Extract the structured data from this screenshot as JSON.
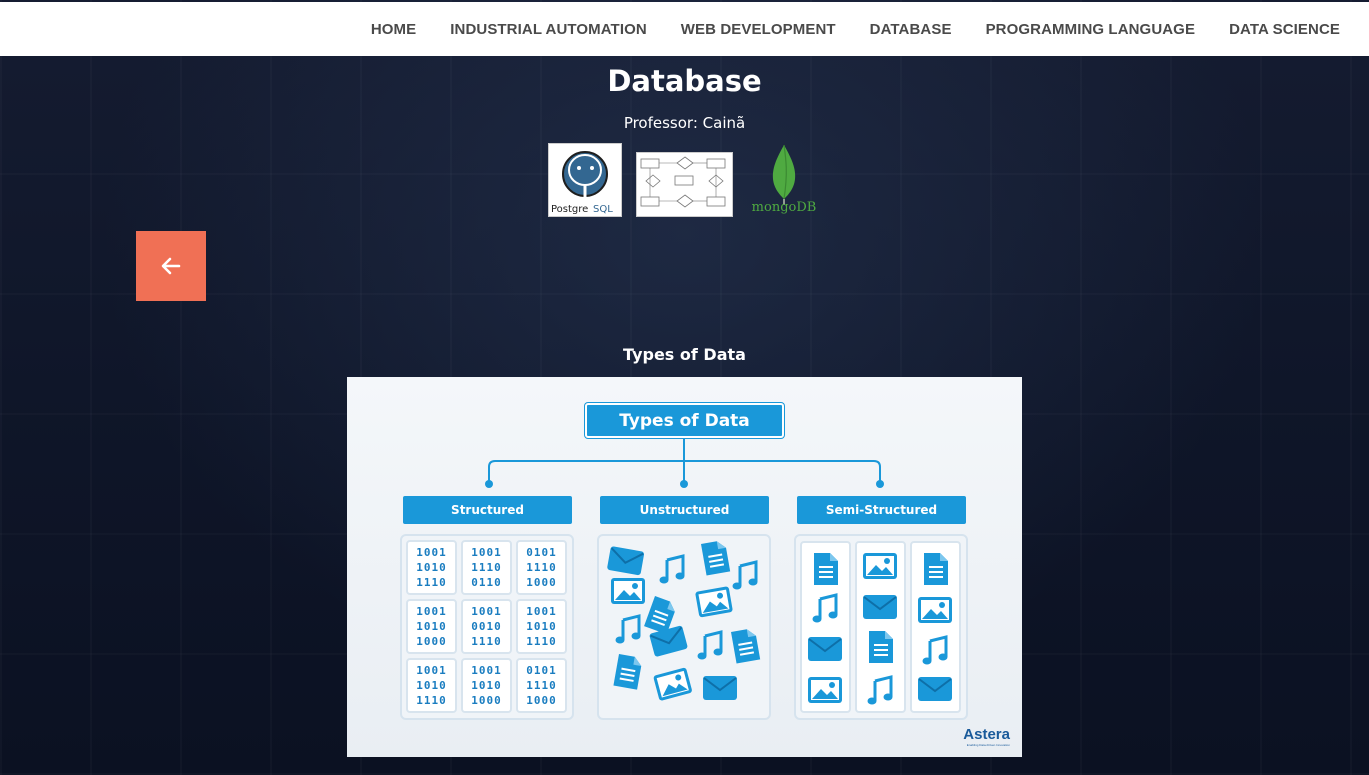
{
  "nav": {
    "items": [
      {
        "label": "HOME"
      },
      {
        "label": "INDUSTRIAL AUTOMATION"
      },
      {
        "label": "WEB DEVELOPMENT"
      },
      {
        "label": "DATABASE"
      },
      {
        "label": "PROGRAMMING LANGUAGE"
      },
      {
        "label": "DATA SCIENCE"
      }
    ]
  },
  "page": {
    "title": "Database",
    "professor": "Professor: Cainã"
  },
  "logos": {
    "postgres_text_left": "Postgre",
    "postgres_text_right": "SQL",
    "mongo_text": "mongoDB"
  },
  "back_button": {
    "icon": "arrow-left-icon"
  },
  "section": {
    "title": "Types of Data"
  },
  "figure": {
    "title": "Types of Data",
    "columns": [
      {
        "label": "Structured"
      },
      {
        "label": "Unstructured"
      },
      {
        "label": "Semi-Structured"
      }
    ],
    "binary_cells": [
      [
        "1001",
        "1010",
        "1110"
      ],
      [
        "1001",
        "1110",
        "0110"
      ],
      [
        "0101",
        "1110",
        "1000"
      ],
      [
        "1001",
        "1010",
        "1000"
      ],
      [
        "1001",
        "0010",
        "1110"
      ],
      [
        "1001",
        "1010",
        "1110"
      ],
      [
        "1001",
        "1010",
        "1110"
      ],
      [
        "1001",
        "1010",
        "1000"
      ],
      [
        "0101",
        "1110",
        "1000"
      ]
    ],
    "brand": "Astera",
    "brand_tagline": "Enabling Data-Driven Innovation"
  },
  "colors": {
    "accent_orange": "#f07055",
    "figure_blue": "#1a98d9",
    "mongo_green": "#4faa41",
    "postgres_blue": "#336791"
  }
}
